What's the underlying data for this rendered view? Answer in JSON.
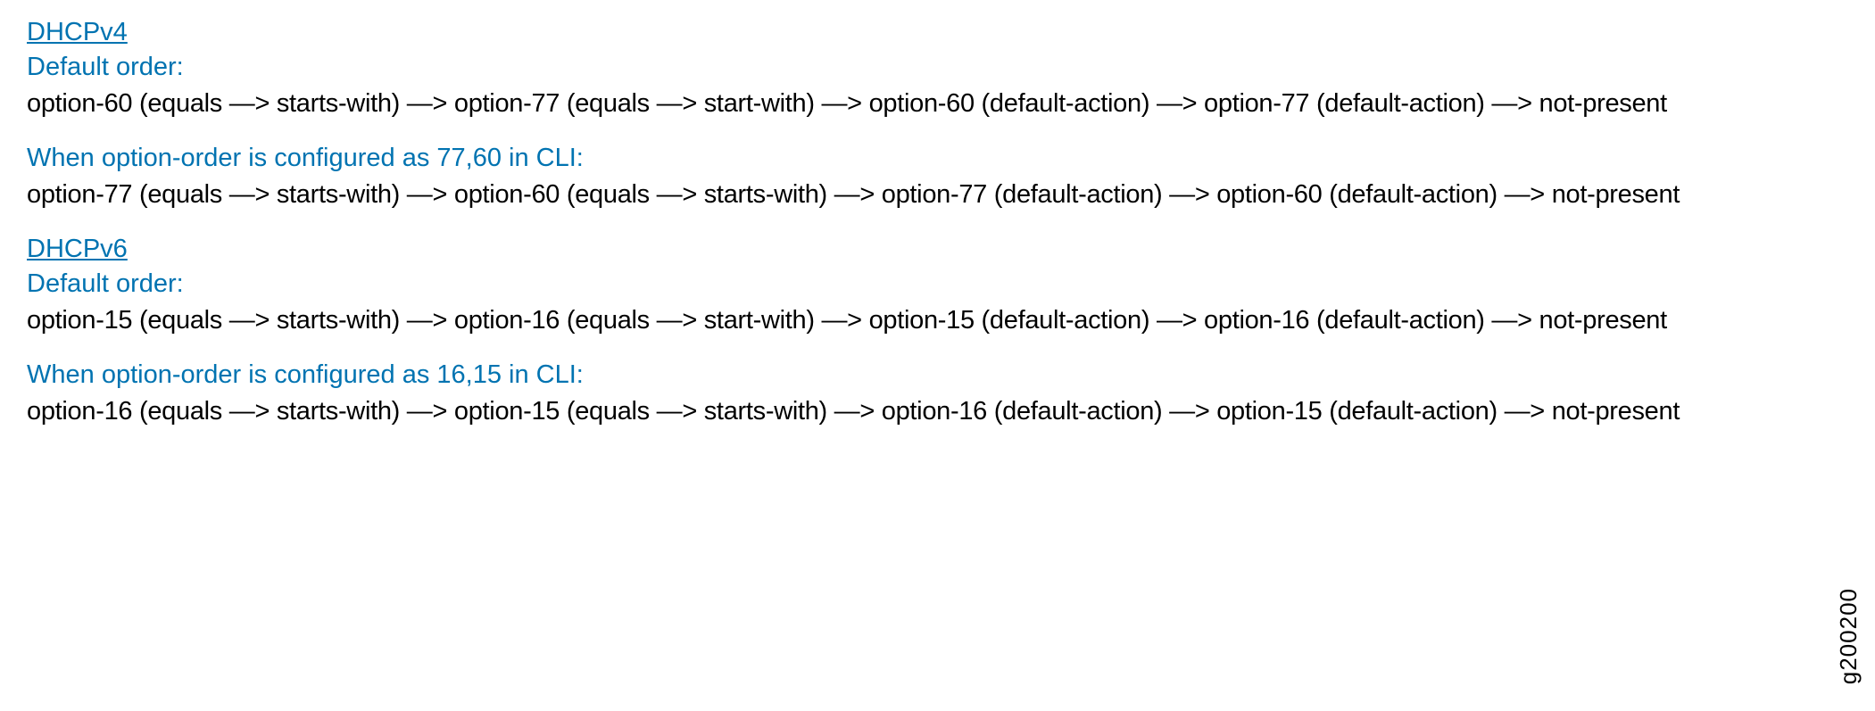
{
  "dhcpv4": {
    "title": "DHCPv4",
    "default_label": "Default  order:",
    "default_content": "option-60 (equals —> starts-with) —> option-77 (equals —> start-with) —> option-60 (default-action) —> option-77 (default-action) —> not-present",
    "configured_label": "When option-order is configured as 77,60 in CLI:",
    "configured_content": "option-77 (equals —> starts-with) —> option-60 (equals —> starts-with) —> option-77 (default-action) —> option-60 (default-action) —> not-present"
  },
  "dhcpv6": {
    "title": "DHCPv6",
    "default_label": "Default  order:",
    "default_content": "option-15 (equals —> starts-with) —> option-16 (equals —> start-with) —> option-15 (default-action) —> option-16 (default-action) —> not-present",
    "configured_label": "When option-order is configured as 16,15 in CLI:",
    "configured_content": "option-16 (equals —> starts-with) —> option-15 (equals —> starts-with) —> option-16 (default-action) —> option-15 (default-action) —> not-present"
  },
  "image_id": "g200200"
}
